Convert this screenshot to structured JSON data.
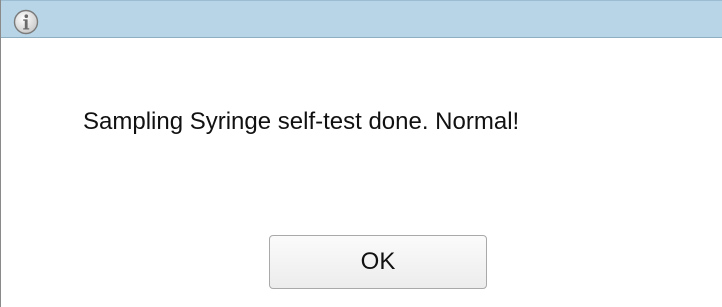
{
  "dialog": {
    "icon": "info-icon",
    "message": "Sampling Syringe self-test done. Normal!",
    "ok_label": "OK"
  },
  "colors": {
    "titlebar": "#b7d5e6",
    "border": "#8a8a8a",
    "text": "#111111"
  }
}
